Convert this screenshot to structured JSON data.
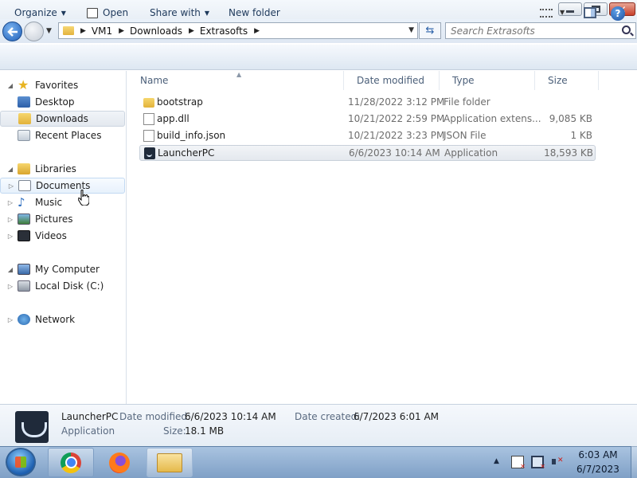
{
  "window": {
    "controls": [
      "minimize",
      "maximize",
      "close"
    ]
  },
  "address": {
    "crumbs": [
      "VM1",
      "Downloads",
      "Extrasofts"
    ],
    "search_placeholder": "Search Extrasofts"
  },
  "toolbar": {
    "organize": "Organize",
    "open": "Open",
    "share_with": "Share with",
    "new_folder": "New folder"
  },
  "nav": {
    "favorites": "Favorites",
    "desktop": "Desktop",
    "downloads": "Downloads",
    "recent_places": "Recent Places",
    "libraries": "Libraries",
    "documents": "Documents",
    "music": "Music",
    "pictures": "Pictures",
    "videos": "Videos",
    "my_computer": "My Computer",
    "local_disk": "Local Disk (C:)",
    "network": "Network"
  },
  "columns": {
    "name": "Name",
    "date_modified": "Date modified",
    "type": "Type",
    "size": "Size"
  },
  "files": [
    {
      "name": "bootstrap",
      "date": "11/28/2022 3:12 PM",
      "type": "File folder",
      "size": "",
      "icon": "folder-icon"
    },
    {
      "name": "app.dll",
      "date": "10/21/2022 2:59 PM",
      "type": "Application extens...",
      "size": "9,085 KB",
      "icon": "dll-file-icon"
    },
    {
      "name": "build_info.json",
      "date": "10/21/2022 3:23 PM",
      "type": "JSON File",
      "size": "1 KB",
      "icon": "json-file-icon"
    },
    {
      "name": "LauncherPC",
      "date": "6/6/2023 10:14 AM",
      "type": "Application",
      "size": "18,593 KB",
      "icon": "application-icon"
    }
  ],
  "details": {
    "name": "LauncherPC",
    "type": "Application",
    "date_modified_label": "Date modified:",
    "date_modified": "6/6/2023 10:14 AM",
    "date_created_label": "Date created:",
    "date_created": "6/7/2023 6:01 AM",
    "size_label": "Size:",
    "size": "18.1 MB"
  },
  "taskbar": {
    "apps": [
      "chrome-icon",
      "firefox-icon",
      "windows-explorer-icon"
    ],
    "time": "6:03 AM",
    "date": "6/7/2023"
  },
  "colors": {
    "accent": "#1f5fb8",
    "selection": "#e4e8ee",
    "taskbar": "#7fa0c6"
  }
}
